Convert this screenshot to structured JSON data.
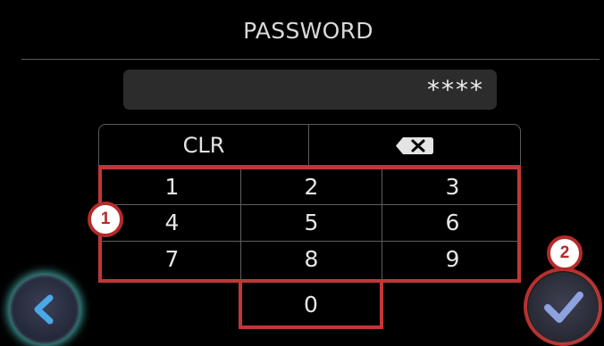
{
  "header": {
    "title": "PASSWORD"
  },
  "password": {
    "masked_value": "****"
  },
  "keypad": {
    "clear_label": "CLR",
    "backspace_icon": "backspace-icon",
    "digits": [
      "1",
      "2",
      "3",
      "4",
      "5",
      "6",
      "7",
      "8",
      "9"
    ],
    "zero": "0"
  },
  "markers": {
    "keypad_marker": "1",
    "confirm_marker": "2"
  },
  "navigation": {
    "back_icon": "chevron-left-icon",
    "confirm_icon": "checkmark-icon"
  },
  "colors": {
    "highlight": "#c23636",
    "back_glow": "#5adcd7",
    "back_chevron": "#4aa8e6",
    "confirm_check": "#8ea2e0"
  }
}
